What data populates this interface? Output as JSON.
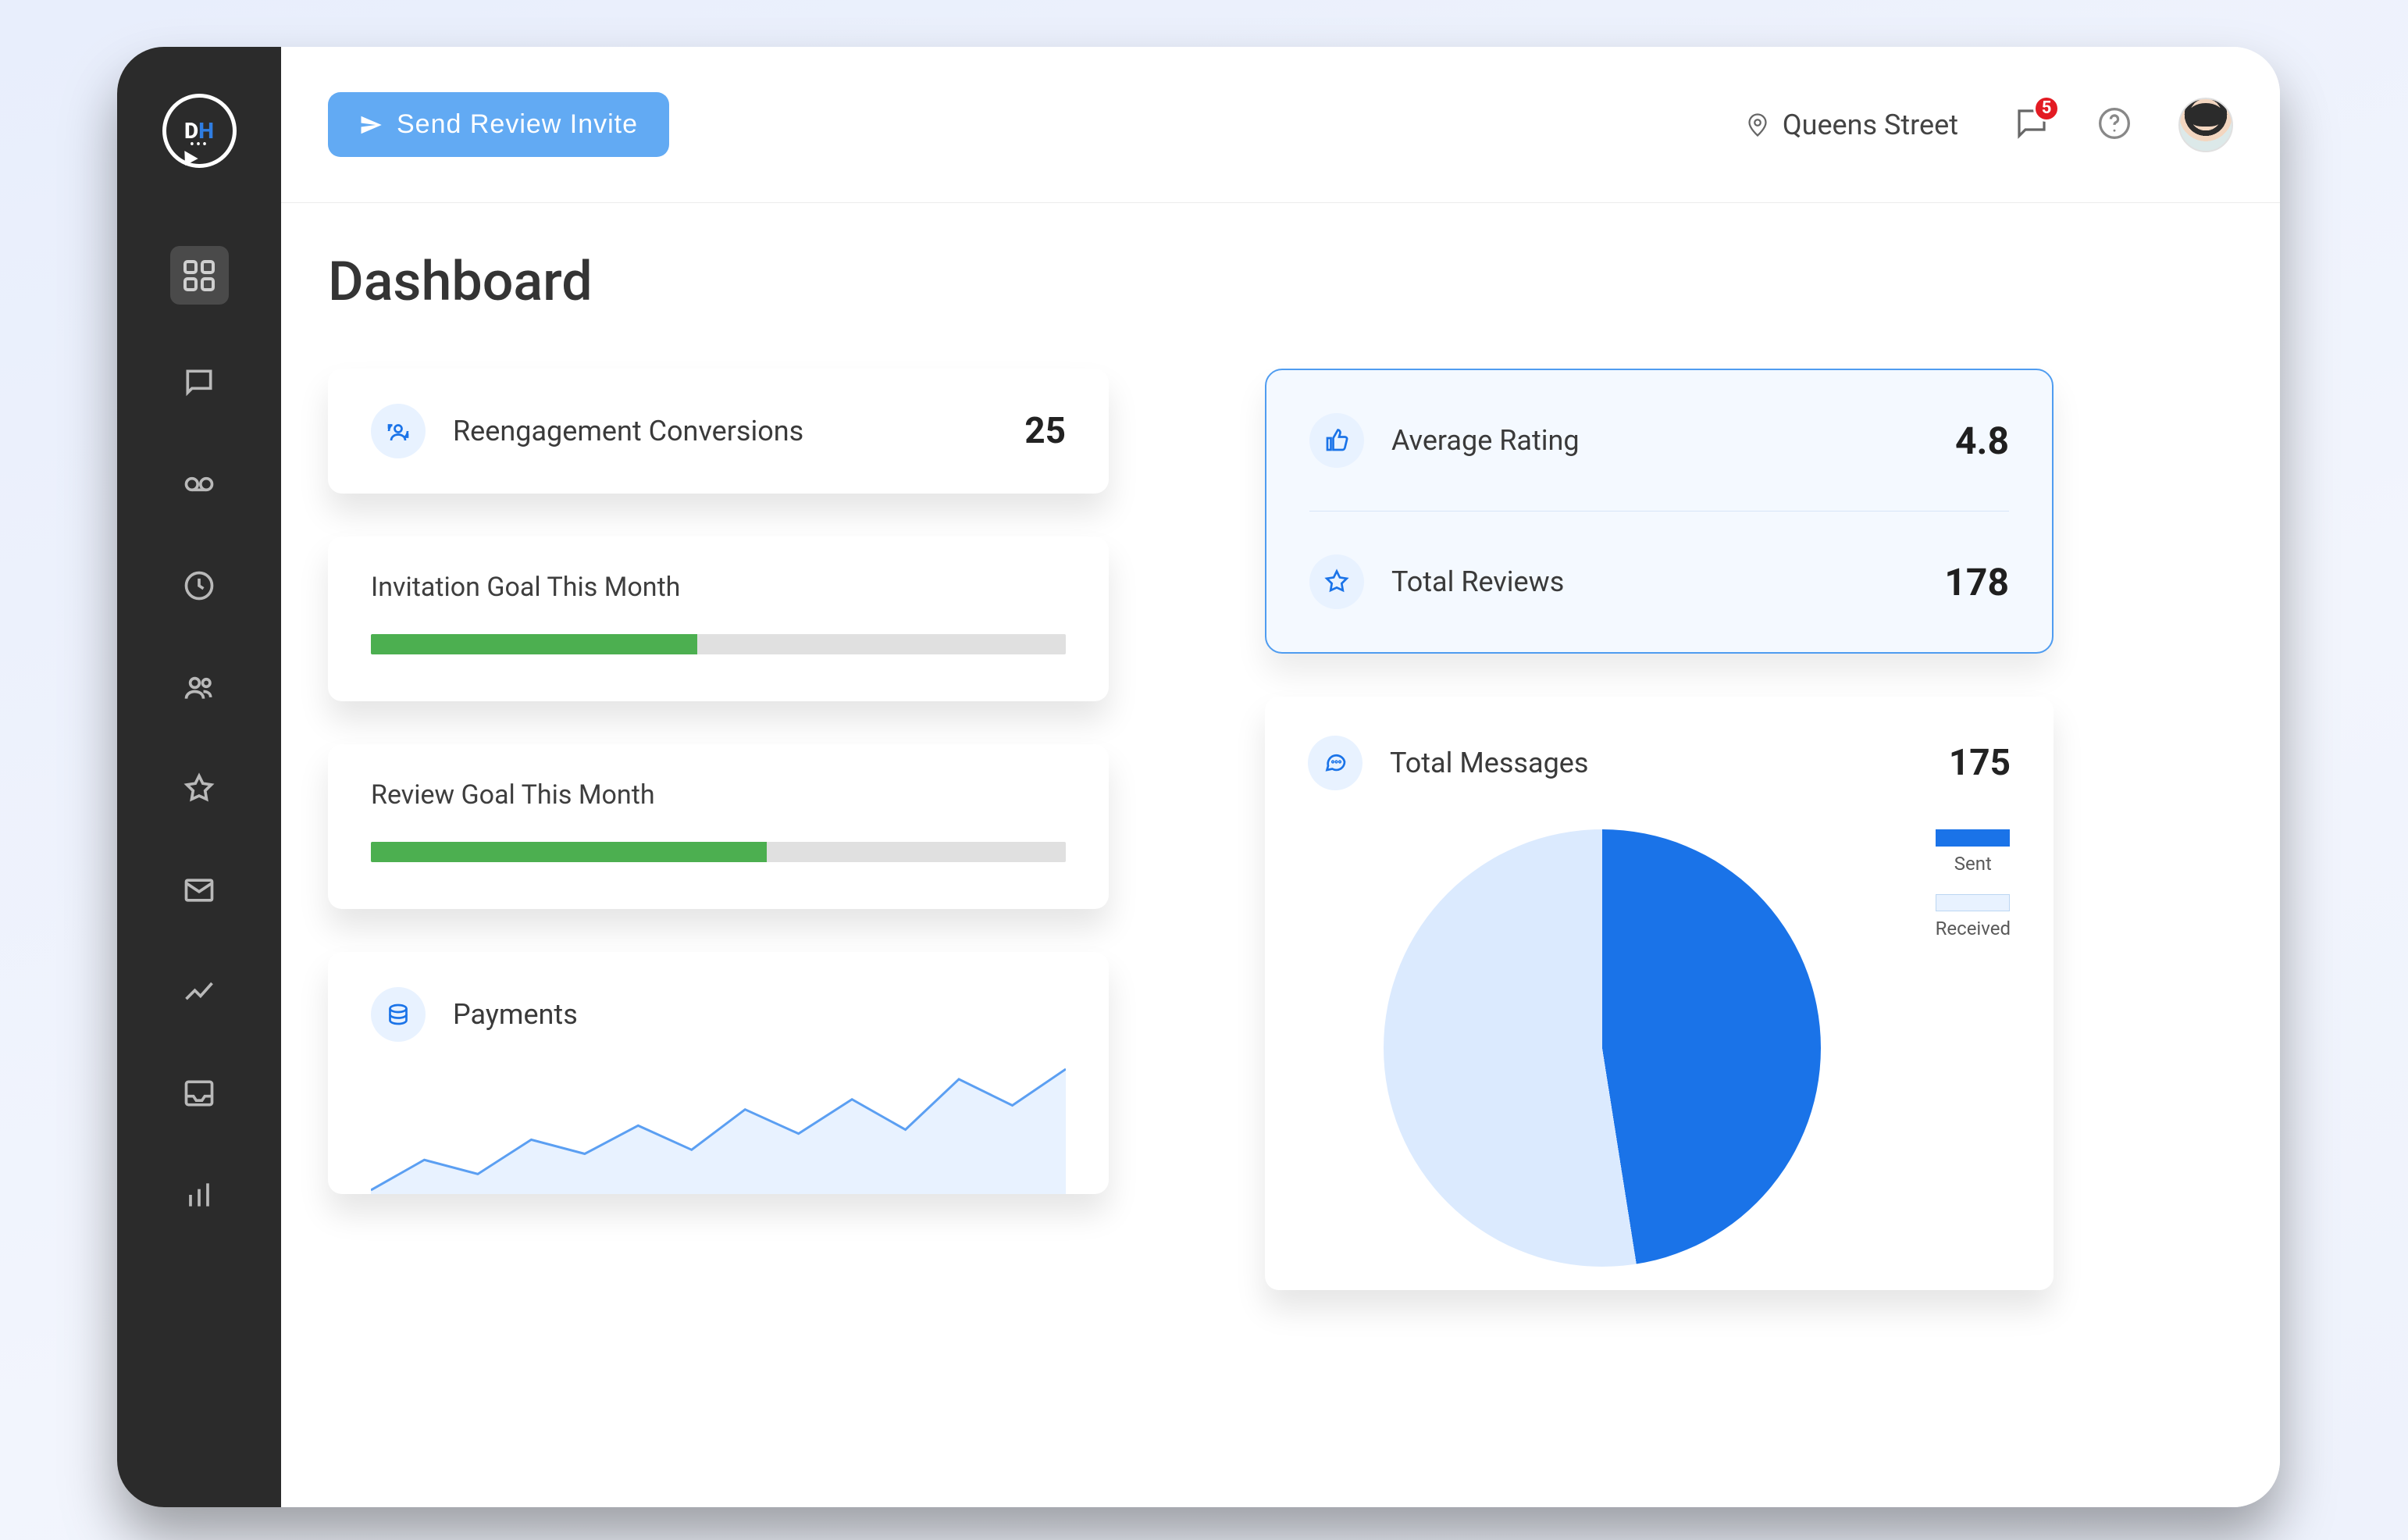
{
  "header": {
    "send_button": "Send Review Invite",
    "location": "Queens Street",
    "notification_count": "5"
  },
  "sidebar": {
    "logo_text_d": "D",
    "logo_text_h": "H",
    "items": [
      {
        "name": "dashboard",
        "active": true
      },
      {
        "name": "messages"
      },
      {
        "name": "voicemail"
      },
      {
        "name": "history"
      },
      {
        "name": "contacts"
      },
      {
        "name": "reviews"
      },
      {
        "name": "email"
      },
      {
        "name": "analytics"
      },
      {
        "name": "inbox"
      },
      {
        "name": "reports"
      }
    ]
  },
  "page": {
    "title": "Dashboard"
  },
  "metrics": {
    "reengagement": {
      "label": "Reengagement Conversions",
      "value": "25"
    },
    "invitation_goal": {
      "label": "Invitation Goal This Month",
      "progress_pct": 47
    },
    "review_goal": {
      "label": "Review Goal This Month",
      "progress_pct": 57
    },
    "payments": {
      "label": "Payments"
    }
  },
  "ratings": {
    "avg": {
      "label": "Average Rating",
      "value": "4.8"
    },
    "total": {
      "label": "Total Reviews",
      "value": "178"
    }
  },
  "messages": {
    "label": "Total Messages",
    "value": "175",
    "legend": {
      "sent": "Sent",
      "received": "Received"
    }
  },
  "chart_data": [
    {
      "type": "pie",
      "title": "Total Messages",
      "series": [
        {
          "name": "Sent",
          "value": 83
        },
        {
          "name": "Received",
          "value": 92
        }
      ],
      "total": 175,
      "colors": {
        "Sent": "#1a73e8",
        "Received": "#dbeafe"
      }
    },
    {
      "type": "bar",
      "title": "Invitation Goal This Month",
      "categories": [
        "progress"
      ],
      "values": [
        47
      ],
      "ylim": [
        0,
        100
      ]
    },
    {
      "type": "bar",
      "title": "Review Goal This Month",
      "categories": [
        "progress"
      ],
      "values": [
        57
      ],
      "ylim": [
        0,
        100
      ]
    },
    {
      "type": "line",
      "title": "Payments",
      "x": [
        0,
        1,
        2,
        3,
        4,
        5,
        6,
        7,
        8,
        9,
        10,
        11,
        12,
        13
      ],
      "values": [
        30,
        45,
        38,
        55,
        48,
        62,
        50,
        70,
        58,
        75,
        60,
        85,
        72,
        90
      ]
    }
  ]
}
